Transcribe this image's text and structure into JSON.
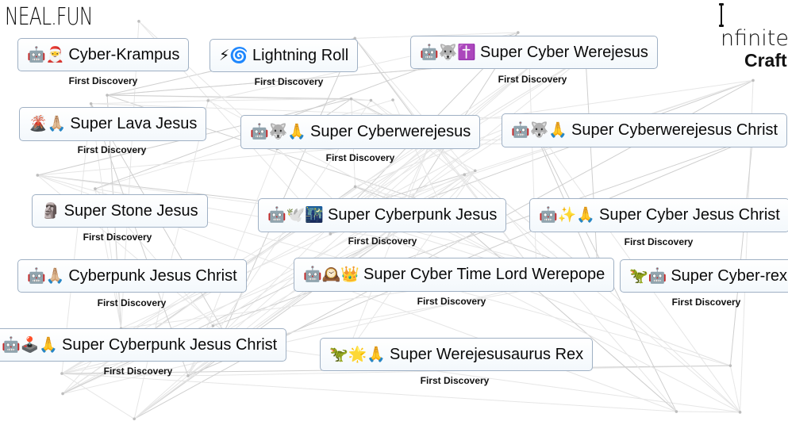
{
  "header": {
    "site_logo": "NEAL.FUN",
    "game_title_top": "nfinite",
    "game_title_bottom": "Craft"
  },
  "discovery_label": "First Discovery",
  "elements": [
    {
      "emoji": "🤖🎅",
      "name": "Cyber-Krampus",
      "badge": "First Discovery"
    },
    {
      "emoji": "⚡🌀",
      "name": "Lightning Roll",
      "badge": "First Discovery"
    },
    {
      "emoji": "🤖🐺✝️",
      "name": "Super Cyber Werejesus",
      "badge": "First Discovery"
    },
    {
      "emoji": "🌋🙏🏼",
      "name": "Super Lava Jesus",
      "badge": "First Discovery"
    },
    {
      "emoji": "🤖🐺🙏",
      "name": "Super Cyberwerejesus",
      "badge": "First Discovery"
    },
    {
      "emoji": "🤖🐺🙏",
      "name": "Super Cyberwerejesus Christ",
      "badge": "First Discovery"
    },
    {
      "emoji": "🗿",
      "name": "Super Stone Jesus",
      "badge": "First Discovery"
    },
    {
      "emoji": "🤖🕊️🌃",
      "name": "Super Cyberpunk Jesus",
      "badge": "First Discovery"
    },
    {
      "emoji": "🤖✨🙏",
      "name": "Super Cyber Jesus Christ",
      "badge": "First Discovery"
    },
    {
      "emoji": "🤖🙏🏼",
      "name": "Cyberpunk Jesus Christ",
      "badge": "First Discovery"
    },
    {
      "emoji": "🤖🕰️👑",
      "name": "Super Cyber Time Lord Werepope",
      "badge": "First Discovery"
    },
    {
      "emoji": "🦖🤖",
      "name": "Super Cyber-rex",
      "badge": "First Discovery"
    },
    {
      "emoji": "🤖🕹️🙏",
      "name": "Super Cyberpunk Jesus Christ",
      "badge": "First Discovery"
    },
    {
      "emoji": "🦖🌟🙏",
      "name": "Super Werejesusaurus Rex",
      "badge": "First Discovery"
    }
  ]
}
